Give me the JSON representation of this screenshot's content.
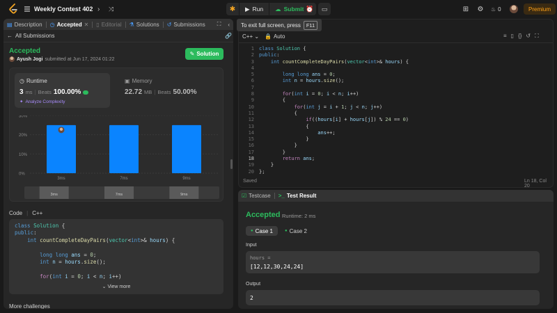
{
  "topbar": {
    "contest_title": "Weekly Contest 402",
    "run_label": "Run",
    "submit_label": "Submit",
    "streak_count": "0",
    "premium_label": "Premium"
  },
  "toast": {
    "text": "To exit full screen, press",
    "key": "F11"
  },
  "left_tabs": [
    {
      "label": "Description",
      "icon": "description-icon"
    },
    {
      "label": "Accepted",
      "icon": "clock-icon"
    },
    {
      "label": "Editorial",
      "icon": "book-icon"
    },
    {
      "label": "Solutions",
      "icon": "flask-icon"
    },
    {
      "label": "Submissions",
      "icon": "history-icon"
    }
  ],
  "submission": {
    "back_label": "All Submissions",
    "status": "Accepted",
    "author": "Ayush Jogi",
    "submitted_at": "submitted at Jun 17, 2024 01:22",
    "solution_button": "Solution",
    "runtime_label": "Runtime",
    "runtime_value": "3",
    "runtime_unit": "ms",
    "runtime_beats_label": "Beats",
    "runtime_beats": "100.00%",
    "analyze_label": "Analyze Complexity",
    "memory_label": "Memory",
    "memory_value": "22.72",
    "memory_unit": "MB",
    "memory_beats_label": "Beats",
    "memory_beats": "50.00%"
  },
  "chart_data": {
    "type": "bar",
    "categories": [
      "3ms",
      "7ms",
      "9ms"
    ],
    "values": [
      25,
      25,
      25
    ],
    "ylim": [
      0,
      30
    ],
    "yticks": [
      "0%",
      "10%",
      "20%",
      "30%"
    ],
    "range_labels": [
      "3ms",
      "7ms",
      "9ms"
    ],
    "bar_color": "#0a84ff",
    "grid": true
  },
  "code_section": {
    "title": "Code",
    "language": "C++",
    "view_more": "View more",
    "more_challenges": "More challenges"
  },
  "editor": {
    "language": "C++",
    "mode": "Auto",
    "status": "Saved",
    "cursor": "Ln 18, Col 20",
    "line_numbers": [
      "1",
      "2",
      "3",
      "4",
      "5",
      "6",
      "7",
      "8",
      "9",
      "10",
      "11",
      "12",
      "13",
      "14",
      "15",
      "16",
      "17",
      "18",
      "19",
      "20"
    ]
  },
  "result": {
    "tab_testcase": "Testcase",
    "tab_result": "Test Result",
    "status": "Accepted",
    "runtime": "Runtime: 2 ms",
    "case1": "Case 1",
    "case2": "Case 2",
    "input_label": "Input",
    "input_var": "hours =",
    "input_value": "[12,12,30,24,24]",
    "output_label": "Output",
    "output_value": "2"
  },
  "colors": {
    "accent_green": "#2cbb5d",
    "brand_orange": "#ffa116",
    "bar_blue": "#0a84ff"
  }
}
